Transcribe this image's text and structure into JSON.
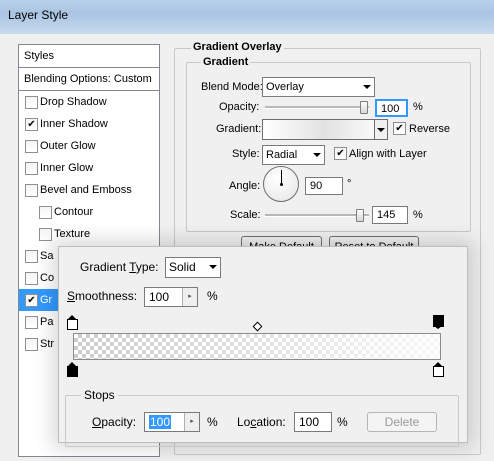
{
  "window": {
    "title": "Layer Style"
  },
  "sidebar": {
    "header": "Styles",
    "blending": "Blending Options: Custom",
    "items": [
      {
        "label": "Drop Shadow",
        "checked": false
      },
      {
        "label": "Inner Shadow",
        "checked": true
      },
      {
        "label": "Outer Glow",
        "checked": false
      },
      {
        "label": "Inner Glow",
        "checked": false
      },
      {
        "label": "Bevel and Emboss",
        "checked": false
      },
      {
        "label": "Contour",
        "checked": false
      },
      {
        "label": "Texture",
        "checked": false
      },
      {
        "label": "Sa",
        "checked": false
      },
      {
        "label": "Co",
        "checked": false
      },
      {
        "label": "Gr",
        "checked": true
      },
      {
        "label": "Pa",
        "checked": false
      },
      {
        "label": "Str",
        "checked": false
      }
    ]
  },
  "panel": {
    "title": "Gradient Overlay",
    "group": "Gradient",
    "blend_label": "Blend Mode:",
    "blend_value": "Overlay",
    "opacity_label": "Opacity:",
    "opacity_value": "100",
    "opacity_unit": "%",
    "gradient_label": "Gradient:",
    "reverse_label": "Reverse",
    "reverse_checked": true,
    "style_label": "Style:",
    "style_value": "Radial",
    "align_label": "Align with Layer",
    "align_checked": true,
    "angle_label": "Angle:",
    "angle_value": "90",
    "angle_unit": "°",
    "scale_label": "Scale:",
    "scale_value": "145",
    "scale_unit": "%",
    "make_default": "Make Default",
    "reset_default": "Reset to Default"
  },
  "popup": {
    "type_label": "Gradient Type:",
    "type_value": "Solid",
    "smooth_label": "Smoothness:",
    "smooth_value": "100",
    "smooth_unit": "%",
    "stops_label": "Stops",
    "opacity_label": "Opacity:",
    "opacity_value": "100",
    "opacity_unit": "%",
    "location_label": "Location:",
    "location_value": "100",
    "location_unit": "%",
    "delete_label": "Delete"
  },
  "colors": {
    "selection": "#3399ff",
    "title_bar": "#b9d1ea"
  }
}
